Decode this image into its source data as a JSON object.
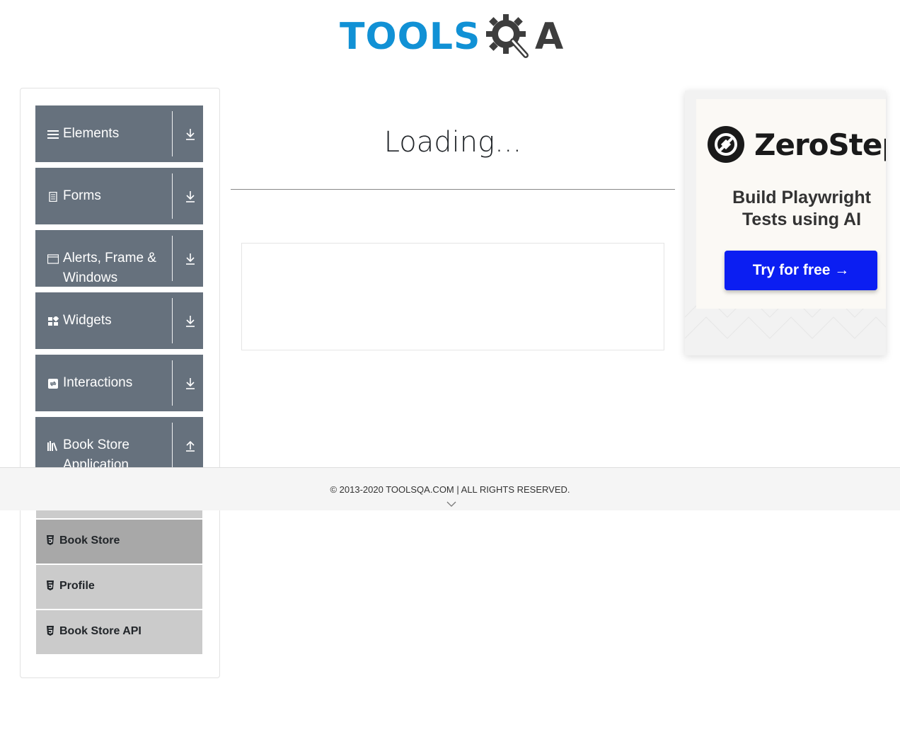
{
  "header": {
    "logo_part1": "TOOLS",
    "logo_part2": "A",
    "logo_alt": "TOOLSQA"
  },
  "sidebar": {
    "groups": [
      {
        "label": "Elements",
        "icon": "menu-lines-icon",
        "arrow": "download-arrow-icon"
      },
      {
        "label": "Forms",
        "icon": "document-icon",
        "arrow": "download-arrow-icon"
      },
      {
        "label": "Alerts, Frame & Windows",
        "icon": "window-icon",
        "arrow": "download-arrow-icon"
      },
      {
        "label": "Widgets",
        "icon": "widgets-icon",
        "arrow": "download-arrow-icon"
      },
      {
        "label": "Interactions",
        "icon": "interactions-icon",
        "arrow": "download-arrow-icon"
      },
      {
        "label": "Book Store Application",
        "icon": "books-icon",
        "arrow": "upload-arrow-icon"
      }
    ],
    "submenu": [
      {
        "label": "Book Store",
        "icon": "html5-icon",
        "active": true
      },
      {
        "label": "Profile",
        "icon": "html5-icon",
        "active": false
      },
      {
        "label": "Book Store API",
        "icon": "html5-icon",
        "active": false
      }
    ]
  },
  "main": {
    "loading_text": "Loading..."
  },
  "ad": {
    "brand": "ZeroStep",
    "tagline_line1": "Build Playwright",
    "tagline_line2": "Tests using AI",
    "cta": "Try for free →",
    "cta_color": "#0b1ef2"
  },
  "footer": {
    "copyright": "© 2013-2020 TOOLSQA.COM | ALL RIGHTS RESERVED."
  },
  "colors": {
    "brand_blue": "#1191d5",
    "sidebar_bg": "#66717d",
    "submenu_bg": "#cbcbcb",
    "submenu_active_bg": "#a8a8a8"
  }
}
